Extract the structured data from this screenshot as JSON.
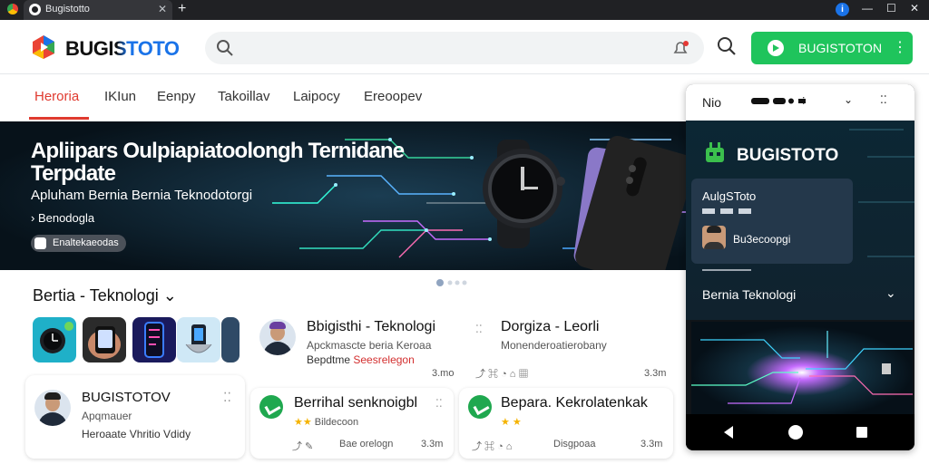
{
  "browser": {
    "tab_title": "Bugistotto",
    "tab_close": "✕",
    "new_tab": "+",
    "info_glyph": "i",
    "window_controls": [
      "—",
      "☐",
      "✕"
    ]
  },
  "header": {
    "logo_text": "BUGISTOTO",
    "logo_colors": [
      "#ea4335",
      "#1a73e8",
      "#34a853",
      "#fbbc05"
    ],
    "search_placeholder": "",
    "cta_label": "BUGISTOTON",
    "cta_menu": "⋮",
    "accent": "#1fc45c"
  },
  "nav": {
    "items": [
      "Heroria",
      "IKIun",
      "Eenpy",
      "Takoillav",
      "Laipocy",
      "Ereoopev"
    ],
    "active_index": 0,
    "active_color": "#e03a2f"
  },
  "hero": {
    "title": "Apliipars Oulpiapiatoolongh Ternidane Terpdate",
    "subtitle": "Apluham Bernia Bernia Teknodotorgi",
    "bullet": "› Benodogla",
    "chip": "Enaltekaeodas",
    "carousel_count": 4,
    "carousel_active": 0
  },
  "section": {
    "title": "Bertia - Teknologi ⌄"
  },
  "thumbs": [
    "smartwatch-app",
    "hand-phone",
    "neon-phone",
    "robot-hand",
    "tablet"
  ],
  "cards": {
    "left": {
      "title": "BUGISTOTOV",
      "line1": "Apqmauer",
      "line2": "Heroaate Vhritio Vdidy",
      "menu": "⁚⁚"
    },
    "mid_top": {
      "title": "Bbigisthi - Teknologi",
      "line1": "Apckmascte beria Keroaa",
      "line2": "Bepdtme",
      "line2_red": "Seesrelegon",
      "meta_right": "3.mo"
    },
    "mid_bottom": {
      "title": "Berrihal senknoigbl",
      "line1": "Bildecoon",
      "meta_left": "Bae orelogn",
      "meta_right": "3.3m",
      "rating": "★★"
    },
    "right_top": {
      "title": "Dorgiza - Leorli",
      "line1": "Monenderoatierobany",
      "meta_right": "3.3m"
    },
    "right_bottom": {
      "title": "Bepara. Kekrolatenkak",
      "rating": "★ ★",
      "meta_left": "Disgpoaa",
      "meta_right": "3.3m"
    }
  },
  "phone": {
    "status_title": "Nio",
    "brand": "BUGISTOTO",
    "box_title": "AulgSToto",
    "box_name": "Bu3ecoopgi",
    "section_label": "Bernia Teknologi",
    "chevron": "⌄"
  }
}
